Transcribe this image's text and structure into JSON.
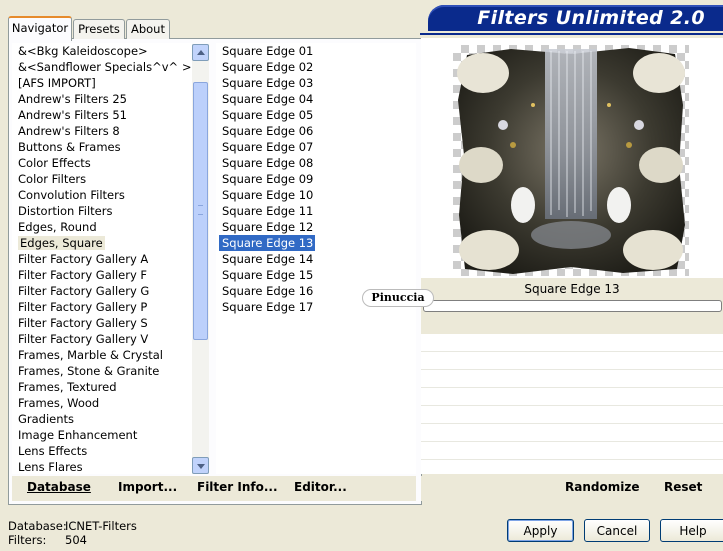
{
  "tabs": [
    "Navigator",
    "Presets",
    "About"
  ],
  "title": "Filters Unlimited 2.0",
  "categories": [
    "&<Bkg Kaleidoscope>",
    "&<Sandflower Specials^v^ >",
    "[AFS IMPORT]",
    "Andrew's Filters 25",
    "Andrew's Filters 51",
    "Andrew's Filters 8",
    "Buttons & Frames",
    "Color Effects",
    "Color Filters",
    "Convolution Filters",
    "Distortion Filters",
    "Edges, Round",
    "Edges, Square",
    "Filter Factory Gallery A",
    "Filter Factory Gallery F",
    "Filter Factory Gallery G",
    "Filter Factory Gallery P",
    "Filter Factory Gallery S",
    "Filter Factory Gallery V",
    "Frames, Marble & Crystal",
    "Frames, Stone & Granite",
    "Frames, Textured",
    "Frames, Wood",
    "Gradients",
    "Image Enhancement",
    "Lens Effects",
    "Lens Flares"
  ],
  "current_category": "Edges, Square",
  "filters": [
    "Square Edge 01",
    "Square Edge 02",
    "Square Edge 03",
    "Square Edge 04",
    "Square Edge 05",
    "Square Edge 06",
    "Square Edge 07",
    "Square Edge 08",
    "Square Edge 09",
    "Square Edge 10",
    "Square Edge 11",
    "Square Edge 12",
    "Square Edge 13",
    "Square Edge 14",
    "Square Edge 15",
    "Square Edge 16",
    "Square Edge 17"
  ],
  "selected_filter": "Square Edge 13",
  "preview_caption": "Square Edge 13",
  "watermark": "Pinuccia",
  "bottom_left": {
    "database": "Database",
    "import": "Import...",
    "filter_info": "Filter Info...",
    "editor": "Editor..."
  },
  "bottom_right": {
    "randomize": "Randomize",
    "reset": "Reset"
  },
  "info": {
    "database_label": "Database:",
    "database_value": "ICNET-Filters",
    "filters_label": "Filters:",
    "filters_value": "504"
  },
  "buttons": {
    "apply": "Apply",
    "cancel": "Cancel",
    "help": "Help"
  },
  "colors": {
    "selection": "#316ac5",
    "banner": "#0a2a8c",
    "dialog": "#ece9d8"
  },
  "icons": [
    "scroll-up-icon",
    "scroll-down-icon"
  ]
}
